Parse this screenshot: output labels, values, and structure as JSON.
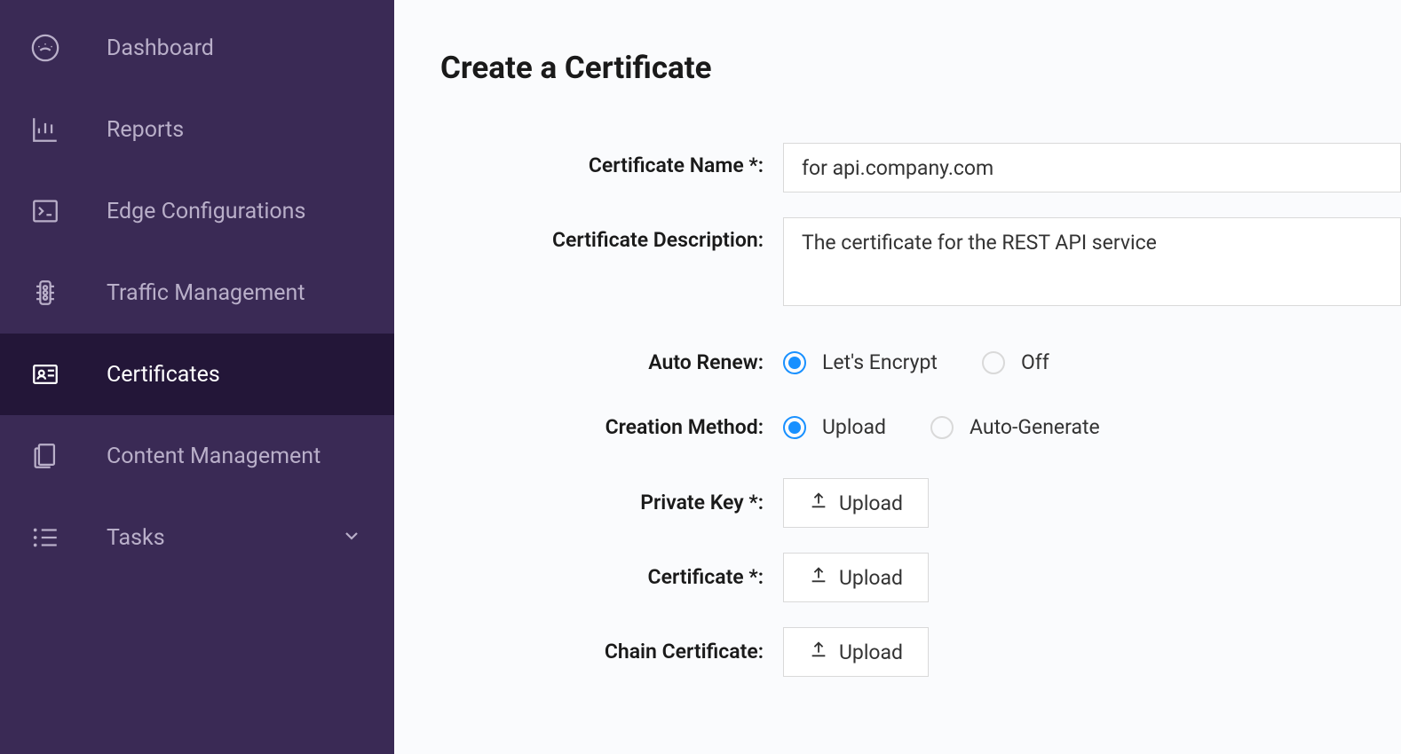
{
  "sidebar": {
    "items": [
      {
        "label": "Dashboard",
        "icon": "dashboard",
        "active": false
      },
      {
        "label": "Reports",
        "icon": "reports",
        "active": false
      },
      {
        "label": "Edge Configurations",
        "icon": "terminal",
        "active": false
      },
      {
        "label": "Traffic Management",
        "icon": "traffic",
        "active": false
      },
      {
        "label": "Certificates",
        "icon": "certificate",
        "active": true
      },
      {
        "label": "Content Management",
        "icon": "content",
        "active": false
      },
      {
        "label": "Tasks",
        "icon": "tasks",
        "active": false,
        "expandable": true
      }
    ]
  },
  "page": {
    "title": "Create a Certificate"
  },
  "form": {
    "certificate_name": {
      "label": "Certificate Name *:",
      "value": "for api.company.com"
    },
    "certificate_description": {
      "label": "Certificate Description:",
      "value": "The certificate for the REST API service"
    },
    "auto_renew": {
      "label": "Auto Renew:",
      "options": [
        {
          "label": "Let's Encrypt",
          "checked": true
        },
        {
          "label": "Off",
          "checked": false
        }
      ]
    },
    "creation_method": {
      "label": "Creation Method:",
      "options": [
        {
          "label": "Upload",
          "checked": true
        },
        {
          "label": "Auto-Generate",
          "checked": false
        }
      ]
    },
    "private_key": {
      "label": "Private Key *:",
      "button": "Upload"
    },
    "certificate": {
      "label": "Certificate *:",
      "button": "Upload"
    },
    "chain_certificate": {
      "label": "Chain Certificate:",
      "button": "Upload"
    }
  }
}
